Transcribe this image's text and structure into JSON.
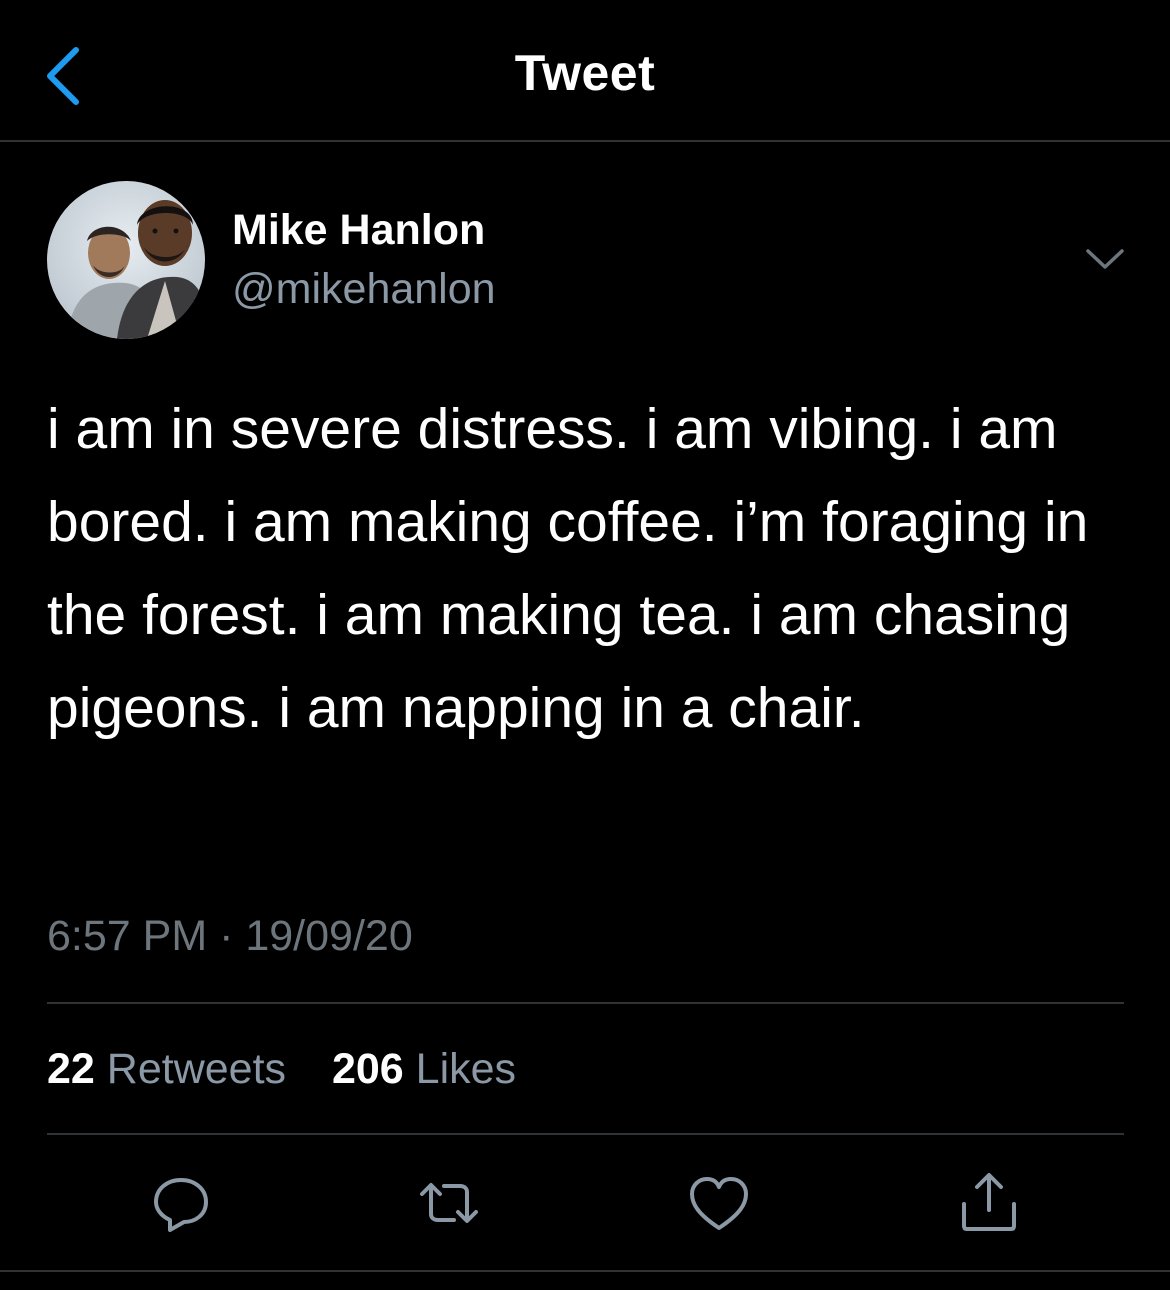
{
  "header": {
    "title": "Tweet",
    "back_icon": "chevron-left-icon"
  },
  "author": {
    "name": "Mike Hanlon",
    "handle": "@mikehanlon"
  },
  "tweet": {
    "text": "i am in severe distress. i am vibing. i am bored. i am making coffee. i’m foraging in the forest. i am making tea. i am chasing pigeons. i am napping in a chair.",
    "timestamp": "6:57 PM · 19/09/20"
  },
  "stats": {
    "retweets_count": "22",
    "retweets_label": "Retweets",
    "likes_count": "206",
    "likes_label": "Likes"
  },
  "actions": [
    "reply-icon",
    "retweet-icon",
    "like-icon",
    "share-icon"
  ],
  "colors": {
    "background": "#000000",
    "accent": "#1d9bf0",
    "secondary_text": "#8b98a5",
    "divider": "#2f3336"
  }
}
